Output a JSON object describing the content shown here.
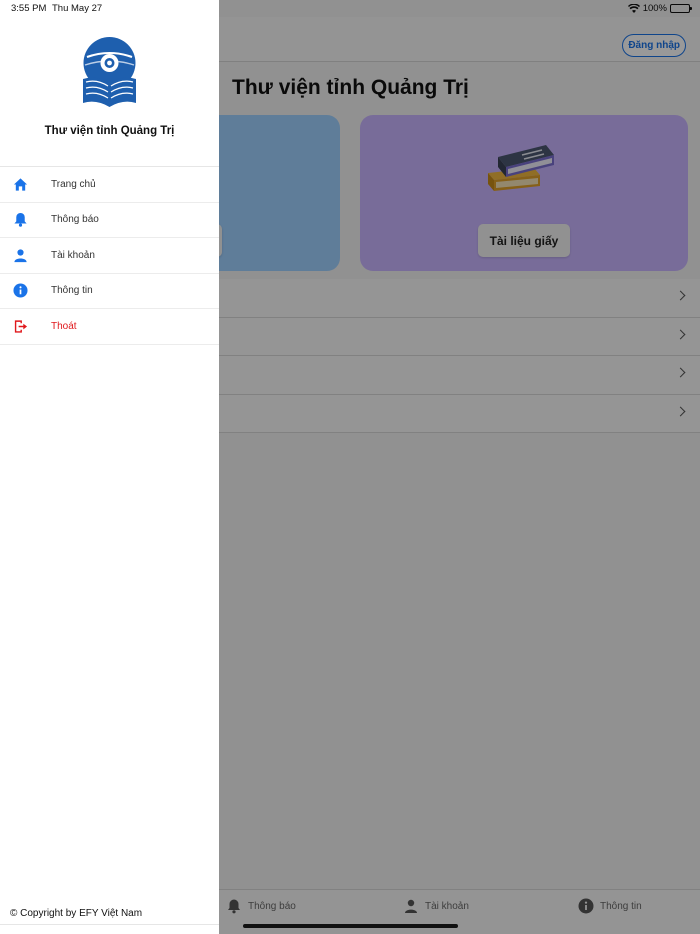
{
  "status_bar": {
    "time": "3:55 PM",
    "date": "Thu May 27",
    "battery": "100%"
  },
  "header": {
    "login_label": "Đăng nhập"
  },
  "main": {
    "title": "Thư viện tỉnh Quảng Trị",
    "cards": [
      {
        "label": "",
        "color": "#9fd0ff"
      },
      {
        "label": "Tài liệu giấy",
        "color": "#c9b5ff"
      }
    ]
  },
  "bottom_tabs": [
    {
      "label": "Thông báo",
      "icon": "bell-icon"
    },
    {
      "label": "Tài khoản",
      "icon": "person-icon"
    },
    {
      "label": "Thông tin",
      "icon": "info-icon"
    }
  ],
  "drawer": {
    "title": "Thư viện tỉnh Quảng Trị",
    "items": [
      {
        "label": "Trang chủ",
        "icon": "home-icon"
      },
      {
        "label": "Thông báo",
        "icon": "bell-icon"
      },
      {
        "label": "Tài khoản",
        "icon": "person-icon"
      },
      {
        "label": "Thông tin",
        "icon": "info-icon"
      },
      {
        "label": "Thoát",
        "icon": "logout-icon"
      }
    ],
    "copyright": "© Copyright by EFY Việt Nam",
    "accent_color": "#1a73e8",
    "logout_color": "#e0181c"
  }
}
